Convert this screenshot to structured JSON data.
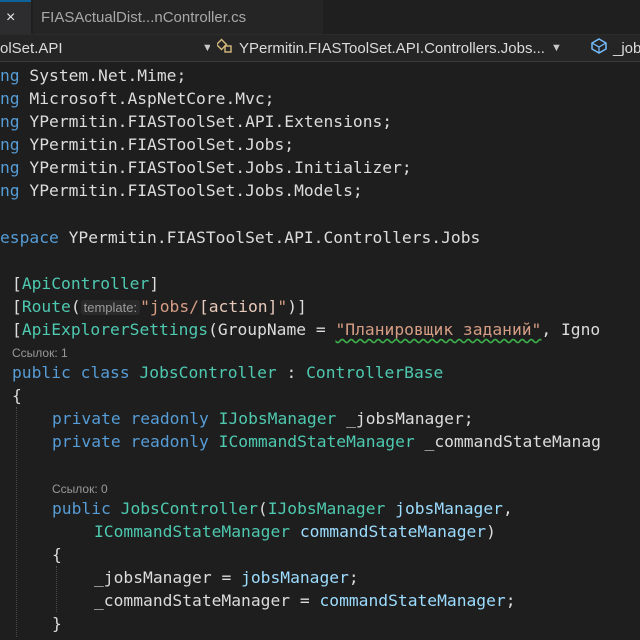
{
  "tabs": {
    "active_close": "×",
    "inactive_label": "FIASActualDist...nController.cs"
  },
  "navbar": {
    "project": "olSet.API",
    "class_path": "YPermitin.FIASToolSet.API.Controllers.Jobs...",
    "member": "_job"
  },
  "code": {
    "usings": [
      {
        "kw": "ng ",
        "ns": "System.Net.Mime;"
      },
      {
        "kw": "ng ",
        "ns": "Microsoft.AspNetCore.Mvc;"
      },
      {
        "kw": "ng ",
        "ns": "YPermitin.FIASToolSet.API.Extensions;"
      },
      {
        "kw": "ng ",
        "ns": "YPermitin.FIASToolSet.Jobs;"
      },
      {
        "kw": "ng ",
        "ns": "YPermitin.FIASToolSet.Jobs.Initializer;"
      },
      {
        "kw": "ng ",
        "ns": "YPermitin.FIASToolSet.Jobs.Models;"
      }
    ],
    "namespace_kw": "espace",
    "namespace_name": " YPermitin.FIASToolSet.API.Controllers.Jobs",
    "attr1_open": "[",
    "attr1_name": "ApiController",
    "attr1_close": "]",
    "attr2_open": "[",
    "attr2_name": "Route",
    "attr2_paren": "(",
    "attr2_hint": "template:",
    "attr2_str_a": "\"jobs/",
    "attr2_str_b": "[action]",
    "attr2_str_c": "\"",
    "attr2_close": ")]",
    "attr3_open": "[",
    "attr3_name": "ApiExplorerSettings",
    "attr3_mid": "(GroupName = ",
    "attr3_str": "\"Планировщик заданий\"",
    "attr3_tail": ", Igno",
    "codelens_class": "Ссылок: 1",
    "class_kw1": "public",
    "class_kw2": "class",
    "class_name": "JobsController",
    "class_colon": " : ",
    "class_base": "ControllerBase",
    "brace_open": "{",
    "field1_kw1": "private",
    "field1_kw2": "readonly",
    "field1_type": "IJobsManager",
    "field1_name": " _jobsManager;",
    "field2_kw1": "private",
    "field2_kw2": "readonly",
    "field2_type": "ICommandStateManager",
    "field2_name": " _commandStateManag",
    "codelens_ctor": "Ссылок: 0",
    "ctor_kw": "public",
    "ctor_name": "JobsController",
    "ctor_paren": "(",
    "ctor_p1_type": "IJobsManager",
    "ctor_p1_name": "jobsManager",
    "ctor_comma": ",",
    "ctor_p2_type": "ICommandStateManager",
    "ctor_p2_name": "commandStateManager",
    "ctor_close": ")",
    "ctor_brace_open": "{",
    "assign1_field": "_jobsManager",
    "assign1_eq": " = ",
    "assign1_val": "jobsManager",
    "assign1_semi": ";",
    "assign2_field": "_commandStateManager",
    "assign2_eq": " = ",
    "assign2_val": "commandStateManager",
    "assign2_semi": ";",
    "ctor_brace_close": "}"
  }
}
